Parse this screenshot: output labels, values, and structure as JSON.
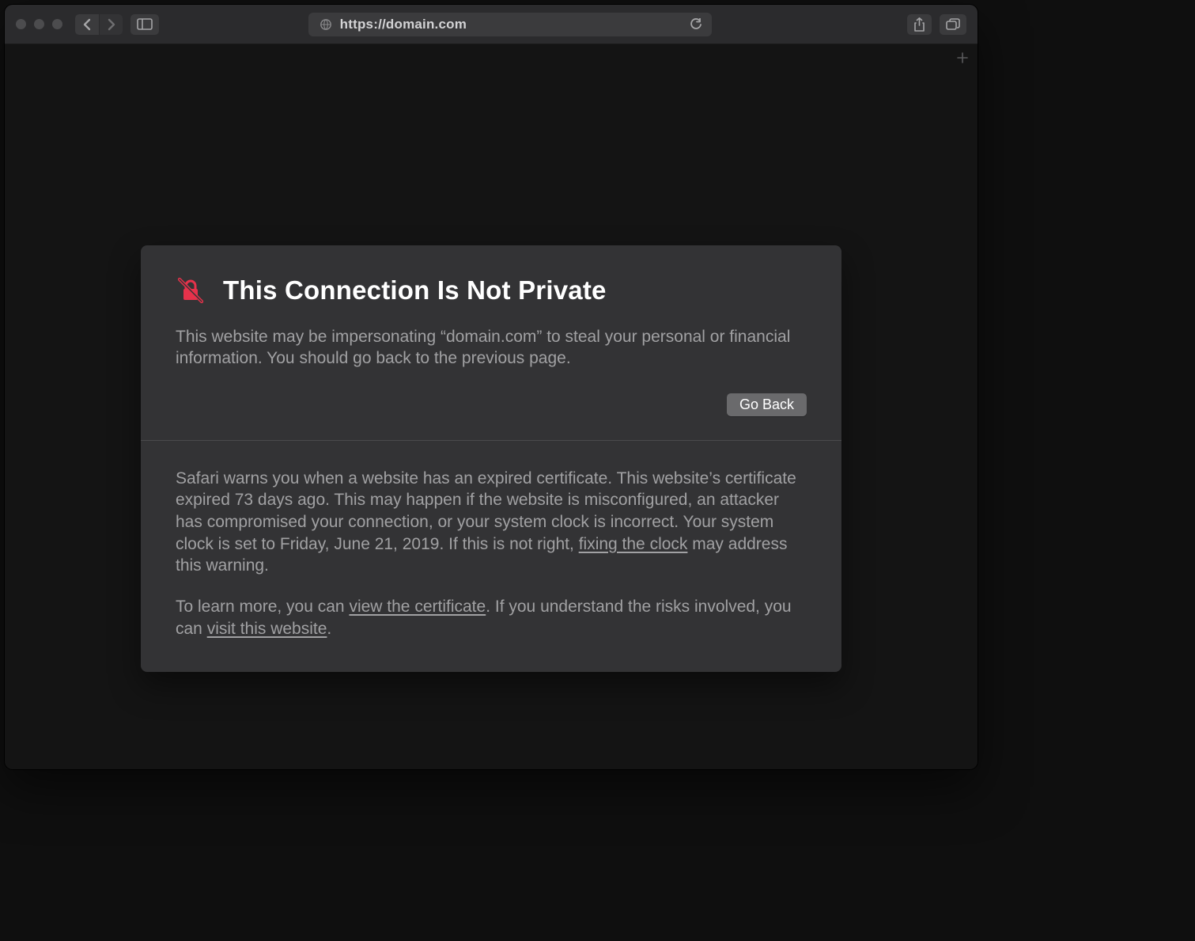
{
  "toolbar": {
    "url": "https://domain.com"
  },
  "warning": {
    "title": "This Connection Is Not Private",
    "summary": "This website may be impersonating “domain.com” to steal your personal or financial information. You should go back to the previous page.",
    "go_back_label": "Go Back",
    "detail_pre": "Safari warns you when a website has an expired certificate. This website’s certificate expired 73 days ago. This may happen if the website is misconfigured, an attacker has compromised your connection, or your system clock is incorrect. Your system clock is set to Friday, June 21, 2019. If this is not right, ",
    "fixing_clock_link": "fixing the clock",
    "detail_post": " may address this warning.",
    "learn_pre": "To learn more, you can ",
    "view_cert_link": "view the certificate",
    "learn_mid": ". If you understand the risks involved, you can ",
    "visit_link": "visit this website",
    "learn_post": "."
  }
}
